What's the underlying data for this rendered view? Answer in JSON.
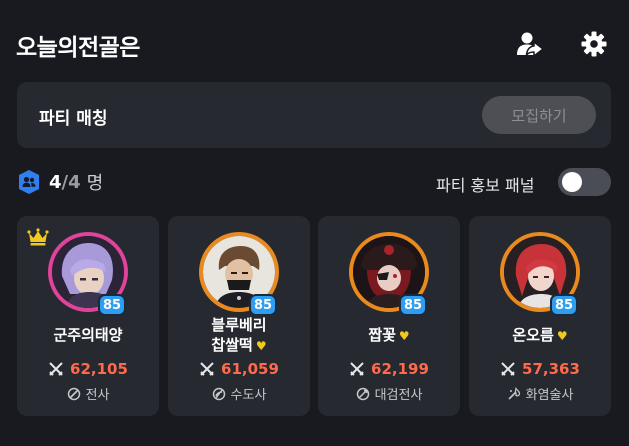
{
  "header": {
    "title": "오늘의전골은",
    "share_icon": "user-share-icon",
    "settings_icon": "gear-icon"
  },
  "match": {
    "title": "파티 매칭",
    "recruit_label": "모집하기"
  },
  "party_count": {
    "current": "4",
    "slash": "/",
    "max": "4",
    "unit": "명"
  },
  "promo": {
    "label": "파티 홍보 패널",
    "enabled": false
  },
  "members": [
    {
      "name": "군주의태양",
      "name_line2": "",
      "level": "85",
      "power": "62,105",
      "class": "전사",
      "leader": true,
      "favorite": false,
      "ring_color": "#e0449a"
    },
    {
      "name": "블루베리",
      "name_line2": "찹쌀떡",
      "level": "85",
      "power": "61,059",
      "class": "수도사",
      "leader": false,
      "favorite": true,
      "ring_color": "#e88a1e"
    },
    {
      "name": "짭꽃",
      "name_line2": "",
      "level": "85",
      "power": "62,199",
      "class": "대검전사",
      "leader": false,
      "favorite": true,
      "ring_color": "#e88a1e"
    },
    {
      "name": "온오름",
      "name_line2": "",
      "level": "85",
      "power": "57,363",
      "class": "화염술사",
      "leader": false,
      "favorite": true,
      "ring_color": "#e88a1e"
    }
  ],
  "colors": {
    "background": "#181a1f",
    "panel": "#262930",
    "power": "#ff6a4c",
    "level_badge": "#2f9ef0",
    "favorite": "#f2c81c",
    "party_icon": "#2f7ff0"
  }
}
